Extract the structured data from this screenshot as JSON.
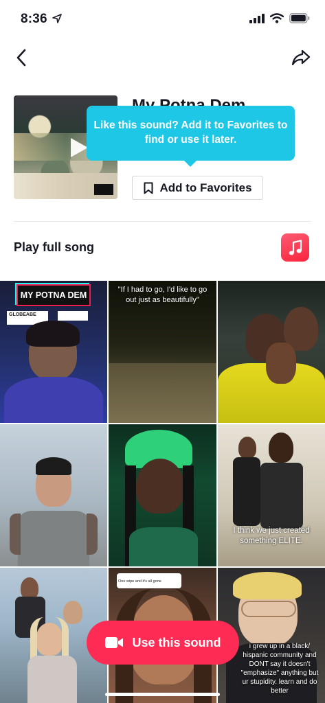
{
  "status_bar": {
    "time": "8:36"
  },
  "header": {
    "back_icon": "chevron-left-icon",
    "share_icon": "share-arrow-icon"
  },
  "sound": {
    "title": "My Potna Dem",
    "add_to_favorites_label": "Add to Favorites",
    "advisory_text": "PARENTAL ADVISORY EXPLICIT CONTENT"
  },
  "tooltip": {
    "text": "Like this sound? Add it to Favorites to find or use it later."
  },
  "full_song": {
    "label": "Play full song",
    "service_icon": "apple-music-icon"
  },
  "videos": [
    {
      "caption": "MY POTNA DEM",
      "strip_left": "GLOBEABE",
      "strip_right": ""
    },
    {
      "caption": "\"If I had to go, I'd like to go out just as beautifully\""
    },
    {
      "caption": ""
    },
    {
      "caption": ""
    },
    {
      "caption": ""
    },
    {
      "caption": "I think we just created something ELITE."
    },
    {
      "caption": ""
    },
    {
      "caption": "One wipe and it's all gone"
    },
    {
      "caption": "i grew up in a black/ hispanic community and DONT say it doesn't \"emphasize\" anything but ur stupidity. learn and do better"
    }
  ],
  "action": {
    "use_sound_label": "Use this sound"
  },
  "colors": {
    "accent_red": "#fe2c55",
    "tooltip_cyan": "#1ec7e6",
    "text_dark": "#161823"
  }
}
